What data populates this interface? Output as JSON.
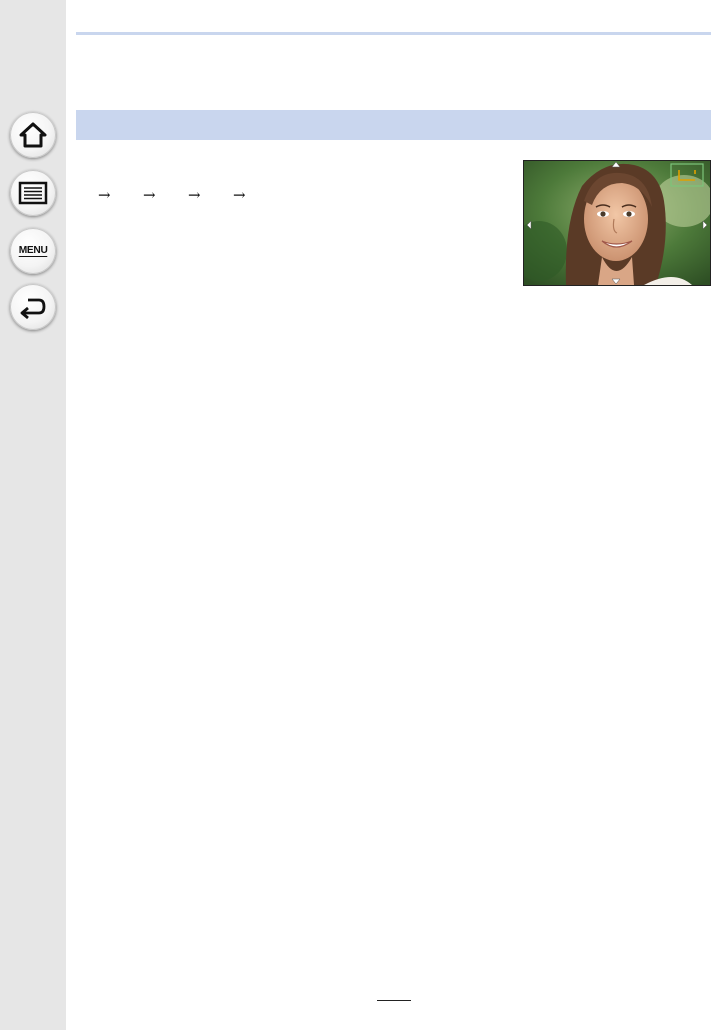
{
  "sidebar": {
    "buttons": [
      {
        "name": "home",
        "icon": "home-icon"
      },
      {
        "name": "contents",
        "icon": "list-icon"
      },
      {
        "name": "menu",
        "icon": "menu-icon",
        "label": "MENU"
      },
      {
        "name": "back",
        "icon": "back-icon"
      }
    ]
  },
  "content": {
    "arrows": [
      "→",
      "→",
      "→",
      "→"
    ]
  },
  "image": {
    "description_icon": "face-detection-photo",
    "af_frame_color": "#e0a000",
    "corner_frame_color": "#7cc47a"
  },
  "colors": {
    "accent": "#c9d6ee",
    "sidebar": "#e6e6e6"
  }
}
